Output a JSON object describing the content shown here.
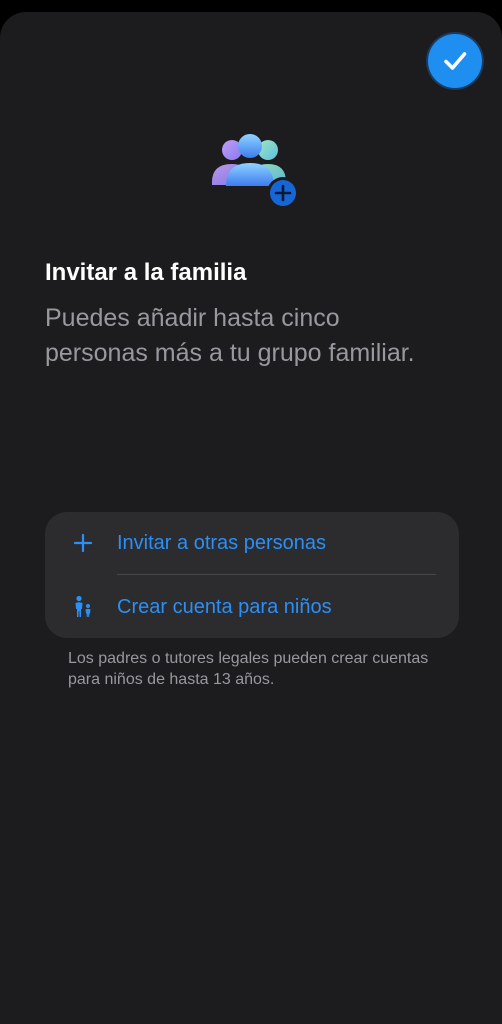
{
  "colors": {
    "background": "#1c1c1e",
    "group_background": "#2c2c2e",
    "accent": "#2b8ff6",
    "done_button": "#1e8ff0",
    "title": "#ffffff",
    "secondary_text": "#98989f"
  },
  "header": {
    "done_icon": "checkmark-icon"
  },
  "hero": {
    "icon": "family-group-add-icon"
  },
  "content": {
    "title": "Invitar a la familia",
    "subtitle": "Puedes añadir hasta cinco personas más a tu grupo familiar."
  },
  "options": [
    {
      "icon": "plus-icon",
      "label": "Invitar a otras personas"
    },
    {
      "icon": "adult-child-icon",
      "label": "Crear cuenta para niños"
    }
  ],
  "footnote": "Los padres o tutores legales pueden crear cuentas para niños de hasta 13 años."
}
